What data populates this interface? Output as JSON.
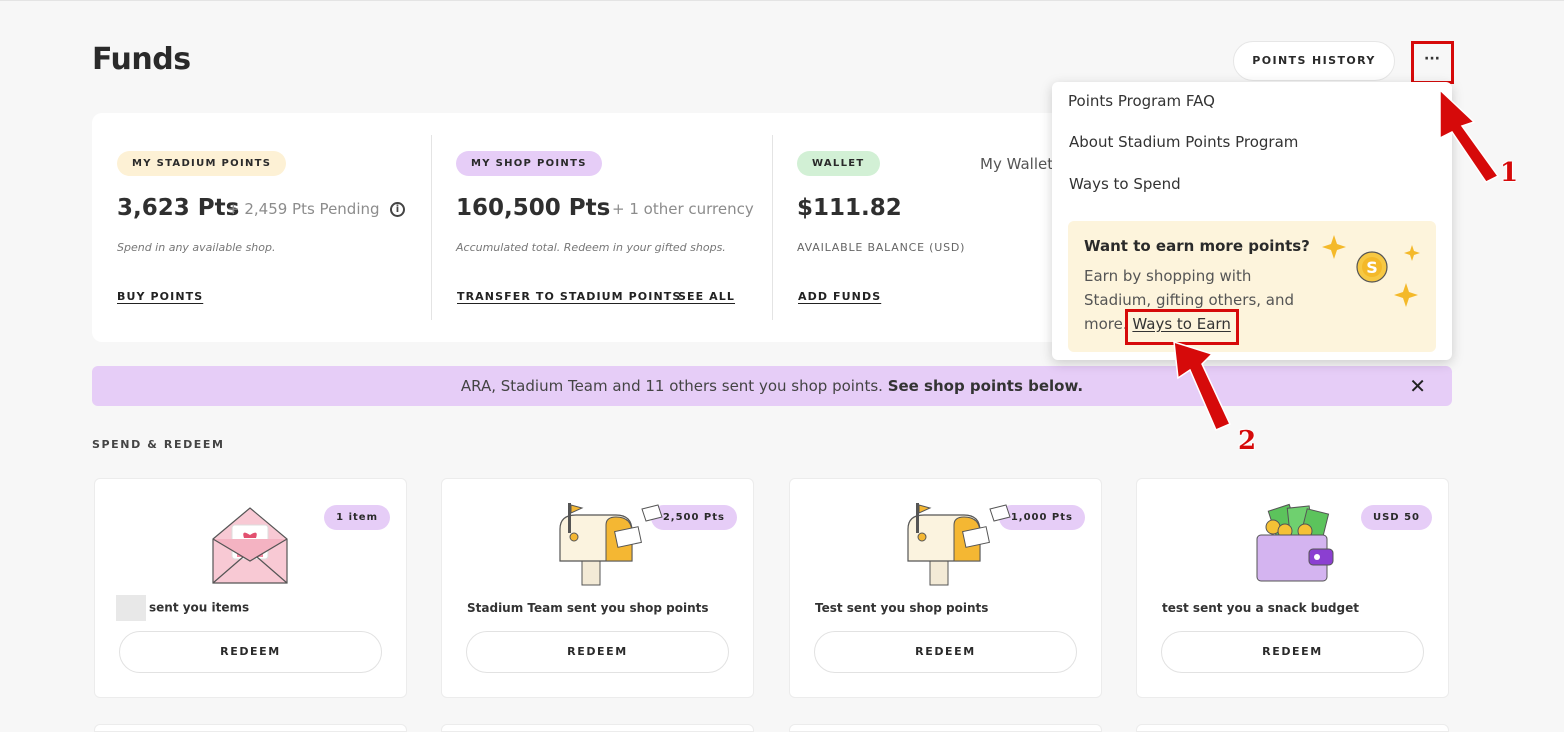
{
  "page": {
    "title": "Funds"
  },
  "header": {
    "points_history_label": "POINTS HISTORY",
    "more_label": "···"
  },
  "summary": {
    "stadium": {
      "tag": "MY STADIUM POINTS",
      "amount": "3,623 Pts",
      "pending": "+ 2,459 Pts Pending",
      "info_icon": "i",
      "note": "Spend in any available shop.",
      "buy_link": "BUY POINTS"
    },
    "shop": {
      "tag": "MY SHOP POINTS",
      "amount": "160,500 Pts",
      "other": "+ 1 other currency",
      "note": "Accumulated total. Redeem in your gifted shops.",
      "transfer_link": "TRANSFER TO STADIUM POINTS",
      "see_all_link": "SEE ALL"
    },
    "wallet": {
      "tag": "WALLET",
      "my_wallet": "My Wallet",
      "amount": "$111.82",
      "balance_label": "AVAILABLE BALANCE (USD)",
      "add_funds_link": "ADD FUNDS"
    }
  },
  "banner": {
    "text": "ARA, Stadium Team and 11 others sent you shop points.",
    "bold_text": "See shop points below.",
    "close_icon": "✕"
  },
  "section_title": "SPEND & REDEEM",
  "cards": [
    {
      "badge": "1 item",
      "text": "sent you items",
      "button": "REDEEM",
      "icon": "gift-envelope-icon"
    },
    {
      "badge": "2,500 Pts",
      "text": "Stadium Team sent you shop points",
      "button": "REDEEM",
      "icon": "mailbox-icon"
    },
    {
      "badge": "1,000 Pts",
      "text": "Test sent you shop points",
      "button": "REDEEM",
      "icon": "mailbox-icon"
    },
    {
      "badge": "USD 50",
      "text": "test sent you a snack budget",
      "button": "REDEEM",
      "icon": "wallet-money-icon"
    }
  ],
  "dropdown": {
    "items": [
      "Points Program FAQ",
      "About Stadium Points Program",
      "Ways to Spend"
    ],
    "promo": {
      "title": "Want to earn more points?",
      "body": "Earn by shopping with Stadium, gifting others, and more.",
      "link": "Ways to Earn"
    }
  },
  "annotations": {
    "one": "1",
    "two": "2"
  },
  "colors": {
    "background": "#f7f7f7",
    "yellow_tag": "#fdf1d5",
    "purple_tag": "#e6cdf7",
    "green_tag": "#d2f0d5",
    "annotation_red": "#d60a0a",
    "promo_bg": "#fdf4dc"
  }
}
